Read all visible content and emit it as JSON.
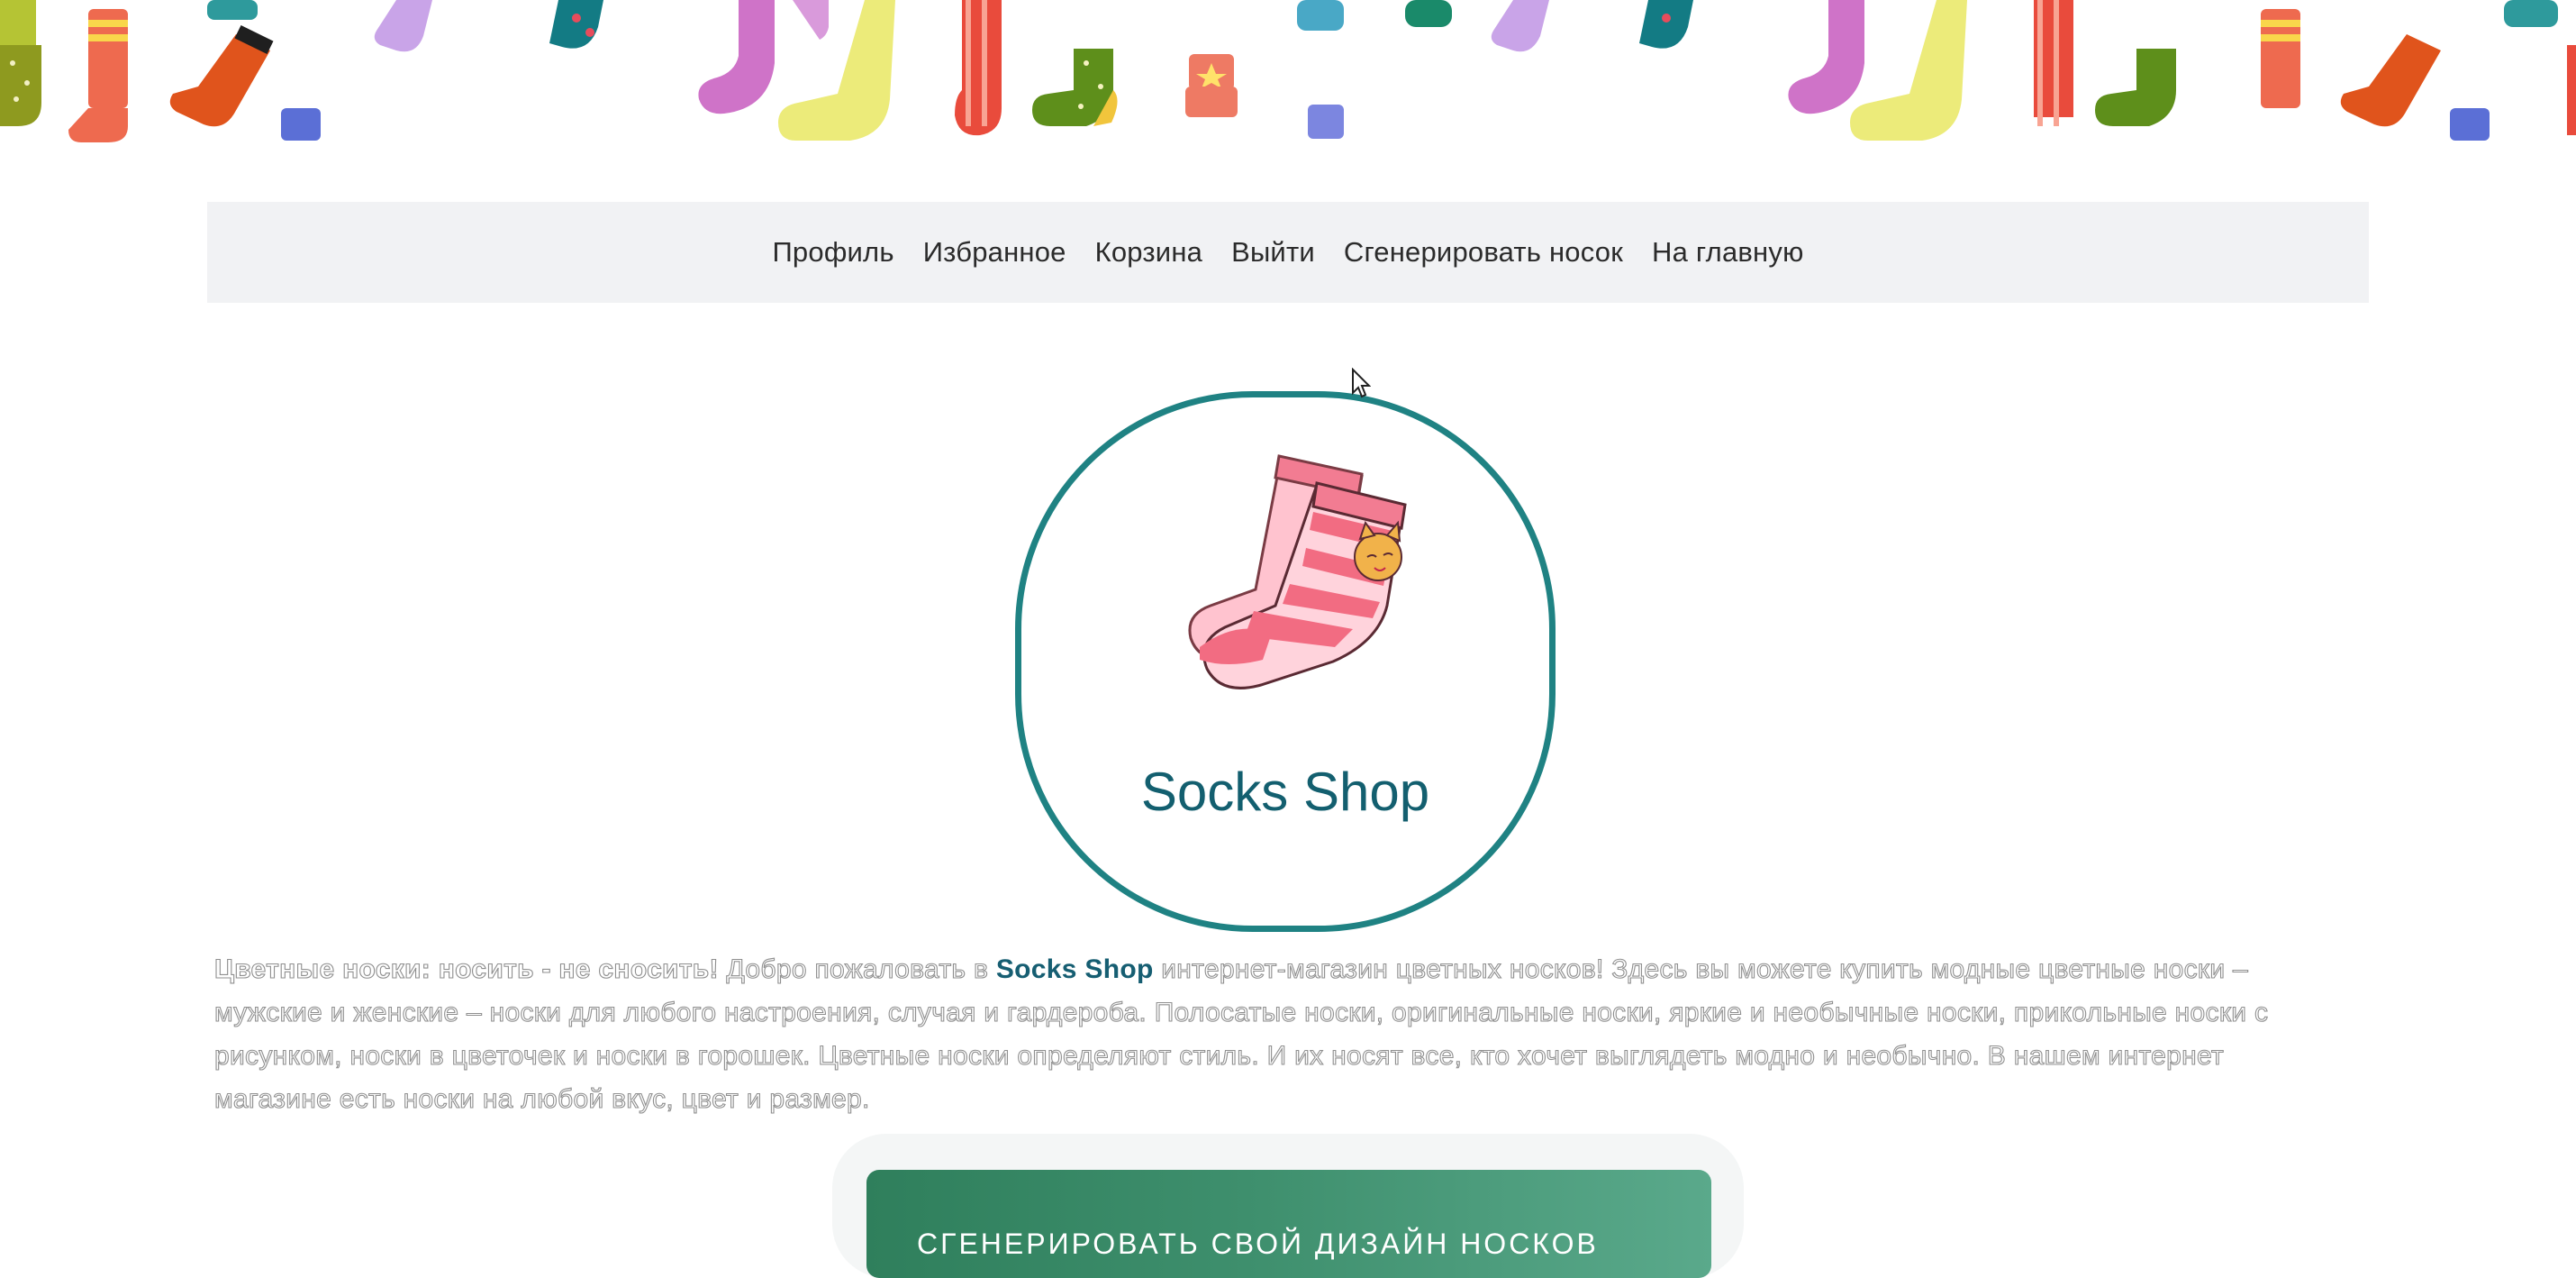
{
  "banner": {
    "icon": "socks-pattern-image"
  },
  "nav": {
    "items": [
      {
        "label": "Профиль"
      },
      {
        "label": "Избранное"
      },
      {
        "label": "Корзина"
      },
      {
        "label": "Выйти"
      },
      {
        "label": "Сгенерировать носок"
      },
      {
        "label": "На главную"
      }
    ]
  },
  "logo": {
    "title": "Socks Shop",
    "icon": "striped-sock-logo",
    "border_color": "#1f8283"
  },
  "description": {
    "lead": "Цветные носки: носить - не сносить!",
    "part1": " Добро пожаловать в ",
    "brand": "Socks Shop",
    "part2": " интернет-магазин цветных носков! Здесь вы можете купить модные цветные носки – мужские и женские – носки для любого настроения, случая и гардероба. Полосатые носки, оригинальные носки, яркие и необычные носки, прикольные носки с рисунком, носки в цветочек и носки в горошек. Цветные носки определяют стиль. И их носят все, кто хочет выглядеть модно и необычно. В нашем интернет магазине есть носки на любой вкус, цвет и размер."
  },
  "cta": {
    "label": "СГЕНЕРИРОВАТЬ СВОЙ ДИЗАЙН НОСКОВ",
    "color": "#3e8f6d"
  }
}
